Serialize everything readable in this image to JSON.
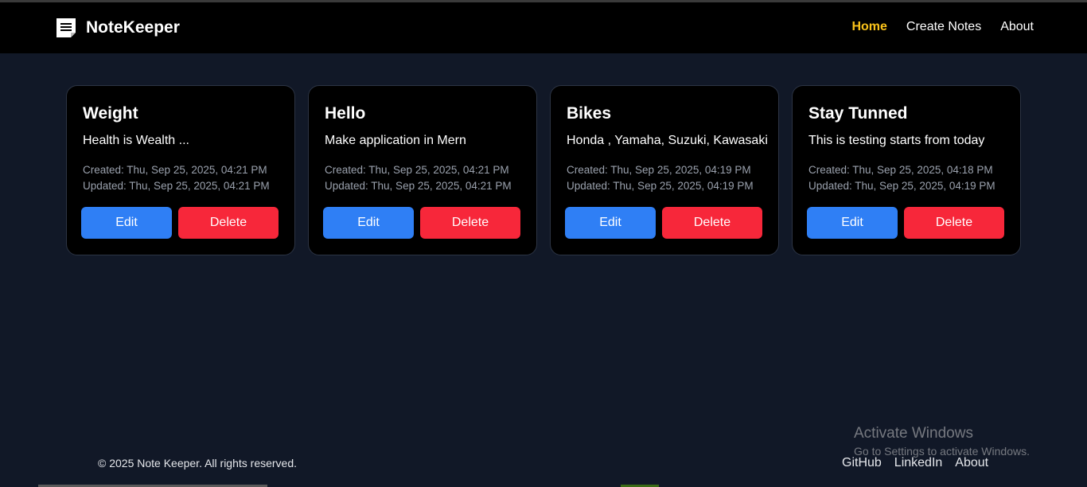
{
  "app": {
    "brand": "NoteKeeper",
    "brand_icon": "note-icon"
  },
  "nav": {
    "items": [
      {
        "label": "Home",
        "active": true
      },
      {
        "label": "Create Notes",
        "active": false
      },
      {
        "label": "About",
        "active": false
      }
    ]
  },
  "notes": [
    {
      "title": "Weight",
      "body": "Health is Wealth ...",
      "created": "Created: Thu, Sep 25, 2025, 04:21 PM",
      "updated": "Updated: Thu, Sep 25, 2025, 04:21 PM",
      "edit_label": "Edit",
      "delete_label": "Delete"
    },
    {
      "title": "Hello",
      "body": "Make application in Mern",
      "created": "Created: Thu, Sep 25, 2025, 04:21 PM",
      "updated": "Updated: Thu, Sep 25, 2025, 04:21 PM",
      "edit_label": "Edit",
      "delete_label": "Delete"
    },
    {
      "title": "Bikes",
      "body": "Honda , Yamaha, Suzuki, Kawasaki",
      "created": "Created: Thu, Sep 25, 2025, 04:19 PM",
      "updated": "Updated: Thu, Sep 25, 2025, 04:19 PM",
      "edit_label": "Edit",
      "delete_label": "Delete"
    },
    {
      "title": "Stay Tunned",
      "body": "This is testing starts from today",
      "created": "Created: Thu, Sep 25, 2025, 04:18 PM",
      "updated": "Updated: Thu, Sep 25, 2025, 04:19 PM",
      "edit_label": "Edit",
      "delete_label": "Delete"
    }
  ],
  "footer": {
    "copyright": "© 2025 Note Keeper. All rights reserved.",
    "links": [
      "GitHub",
      "LinkedIn",
      "About"
    ]
  },
  "watermark": {
    "title": "Activate Windows",
    "subtitle": "Go to Settings to activate Windows."
  },
  "colors": {
    "background": "#111827",
    "navbar": "#000000",
    "active_link": "#f9c21a",
    "edit_button": "#2f7ff5",
    "delete_button": "#f7273a"
  }
}
